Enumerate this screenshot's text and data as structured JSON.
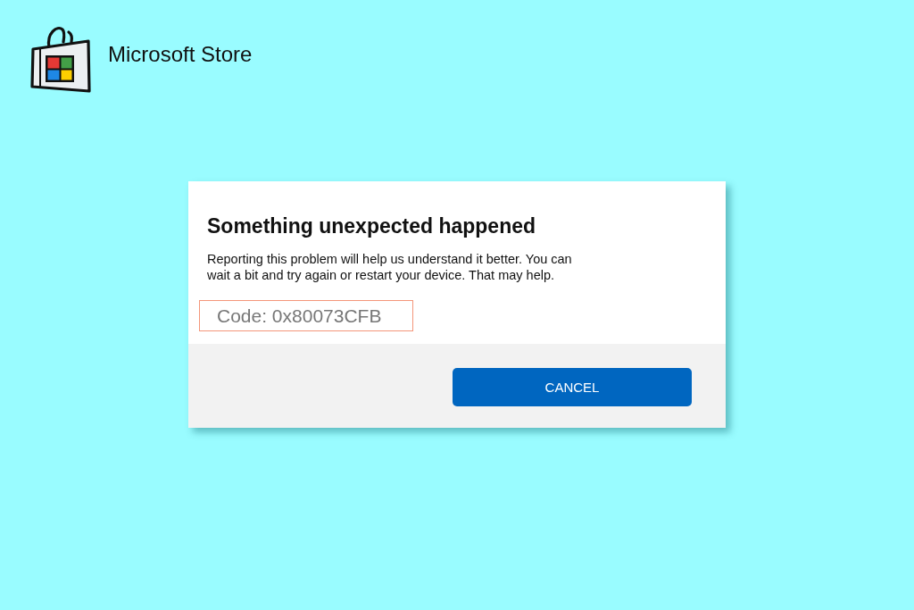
{
  "app": {
    "name": "Microsoft Store"
  },
  "dialog": {
    "title": "Something unexpected happened",
    "message": "Reporting this problem will help us understand it better. You can wait a bit and try again or restart your device. That may help.",
    "error_code": {
      "text": "Code: 0x80073CFB",
      "highlighted": true
    },
    "buttons": [
      {
        "label": "CANCEL"
      }
    ]
  }
}
